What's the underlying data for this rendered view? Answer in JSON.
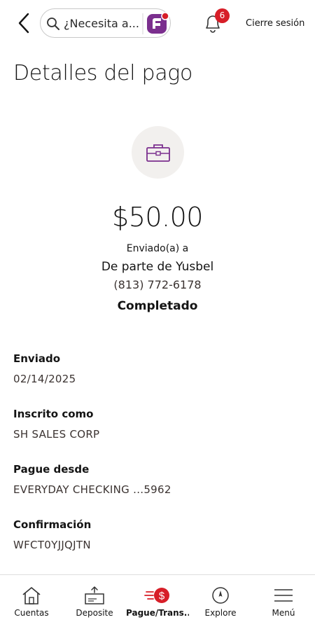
{
  "header": {
    "search_placeholder": "¿Necesita a...",
    "notification_count": "6",
    "logout_label": "Cierre sesión"
  },
  "page": {
    "title": "Detalles del pago"
  },
  "payment": {
    "amount": "$50.00",
    "sent_to_label": "Enviado(a) a",
    "recipient": "De parte de Yusbel",
    "phone": "(813) 772-6178",
    "status": "Completado"
  },
  "details": [
    {
      "label": "Enviado",
      "value": "02/14/2025"
    },
    {
      "label": "Inscrito como",
      "value": "SH SALES CORP"
    },
    {
      "label": "Pague desde",
      "value": "EVERYDAY CHECKING ...5962"
    },
    {
      "label": "Confirmación",
      "value": "WFCT0YJJQJTN"
    }
  ],
  "nav": {
    "items": [
      {
        "label": "Cuentas",
        "icon": "house-icon"
      },
      {
        "label": "Deposite",
        "icon": "deposit-check-icon"
      },
      {
        "label": "Pague/Trans...",
        "icon": "pay-transfer-icon",
        "active": true
      },
      {
        "label": "Explore",
        "icon": "compass-icon"
      },
      {
        "label": "Menú",
        "icon": "hamburger-menu-icon"
      }
    ]
  },
  "colors": {
    "brand_red": "#d71e28",
    "accent_purple": "#7b2f8e",
    "icon_circle_bg": "#f2f0ee"
  }
}
